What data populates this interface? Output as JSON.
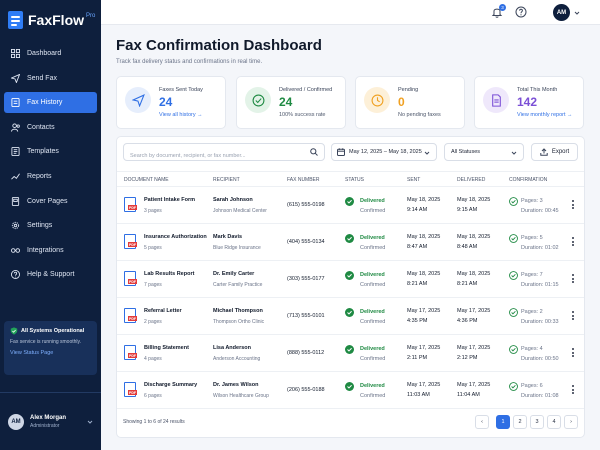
{
  "app": {
    "name": "FaxFlow",
    "badge": "Pro"
  },
  "nav": {
    "items": [
      {
        "label": "Dashboard",
        "icon": "grid-icon"
      },
      {
        "label": "Send Fax",
        "icon": "send-icon"
      },
      {
        "label": "Fax History",
        "icon": "history-icon",
        "active": true
      },
      {
        "label": "Contacts",
        "icon": "contacts-icon"
      },
      {
        "label": "Templates",
        "icon": "template-icon"
      },
      {
        "label": "Reports",
        "icon": "reports-icon"
      },
      {
        "label": "Cover Pages",
        "icon": "cover-icon"
      },
      {
        "label": "Settings",
        "icon": "gear-icon"
      },
      {
        "label": "Integrations",
        "icon": "integrations-icon"
      },
      {
        "label": "Help & Support",
        "icon": "help-icon"
      }
    ]
  },
  "system_status": {
    "title": "All Systems Operational",
    "desc": "Fax service is running smoothly.",
    "link": "View Status Page"
  },
  "user": {
    "initials": "AM",
    "name": "Alex Morgan",
    "role": "Administrator"
  },
  "topbar": {
    "notifications": "3",
    "avatar": "AM"
  },
  "page": {
    "title": "Fax Confirmation Dashboard",
    "subtitle": "Track fax delivery status and confirmations in real time."
  },
  "stats": [
    {
      "label": "Faxes Sent Today",
      "value": "24",
      "sub": "View all history →",
      "color": "#2f6fe4"
    },
    {
      "label": "Delivered / Confirmed",
      "value": "24",
      "sub": "100% success rate",
      "color": "#1f8a43"
    },
    {
      "label": "Pending",
      "value": "0",
      "sub": "No pending faxes",
      "color": "#f0a020"
    },
    {
      "label": "Total This Month",
      "value": "142",
      "sub": "View monthly report →",
      "color": "#7b4fd6"
    }
  ],
  "toolbar": {
    "search_placeholder": "Search by document, recipient, or fax number...",
    "date_range": "May 12, 2025 – May 18, 2025",
    "status_filter": "All Statuses",
    "export": "Export"
  },
  "table": {
    "headers": [
      "DOCUMENT NAME",
      "RECIPIENT",
      "FAX NUMBER",
      "STATUS",
      "SENT",
      "DELIVERED",
      "CONFIRMATION"
    ],
    "rows": [
      {
        "doc": "Patient Intake Form",
        "pages": "3 pages",
        "recipient": "Sarah Johnson",
        "org": "Johnson Medical Center",
        "fax": "(615) 555-0198",
        "status": "Delivered",
        "confirm": "Confirmed",
        "sent_date": "May 18, 2025",
        "sent_time": "9:14 AM",
        "del_date": "May 18, 2025",
        "del_time": "9:15 AM",
        "conf_pages": "Pages: 3",
        "duration": "Duration: 00:45"
      },
      {
        "doc": "Insurance Authorization",
        "pages": "5 pages",
        "recipient": "Mark Davis",
        "org": "Blue Ridge Insurance",
        "fax": "(404) 555-0134",
        "status": "Delivered",
        "confirm": "Confirmed",
        "sent_date": "May 18, 2025",
        "sent_time": "8:47 AM",
        "del_date": "May 18, 2025",
        "del_time": "8:48 AM",
        "conf_pages": "Pages: 5",
        "duration": "Duration: 01:02"
      },
      {
        "doc": "Lab Results Report",
        "pages": "7 pages",
        "recipient": "Dr. Emily Carter",
        "org": "Carter Family Practice",
        "fax": "(303) 555-0177",
        "status": "Delivered",
        "confirm": "Confirmed",
        "sent_date": "May 18, 2025",
        "sent_time": "8:21 AM",
        "del_date": "May 18, 2025",
        "del_time": "8:21 AM",
        "conf_pages": "Pages: 7",
        "duration": "Duration: 01:15"
      },
      {
        "doc": "Referral Letter",
        "pages": "2 pages",
        "recipient": "Michael Thompson",
        "org": "Thompson Ortho Clinic",
        "fax": "(713) 555-0101",
        "status": "Delivered",
        "confirm": "Confirmed",
        "sent_date": "May 17, 2025",
        "sent_time": "4:35 PM",
        "del_date": "May 17, 2025",
        "del_time": "4:36 PM",
        "conf_pages": "Pages: 2",
        "duration": "Duration: 00:33"
      },
      {
        "doc": "Billing Statement",
        "pages": "4 pages",
        "recipient": "Lisa Anderson",
        "org": "Anderson Accounting",
        "fax": "(888) 555-0112",
        "status": "Delivered",
        "confirm": "Confirmed",
        "sent_date": "May 17, 2025",
        "sent_time": "2:11 PM",
        "del_date": "May 17, 2025",
        "del_time": "2:12 PM",
        "conf_pages": "Pages: 4",
        "duration": "Duration: 00:50"
      },
      {
        "doc": "Discharge Summary",
        "pages": "6 pages",
        "recipient": "Dr. James Wilson",
        "org": "Wilson Healthcare Group",
        "fax": "(206) 555-0188",
        "status": "Delivered",
        "confirm": "Confirmed",
        "sent_date": "May 17, 2025",
        "sent_time": "11:03 AM",
        "del_date": "May 17, 2025",
        "del_time": "11:04 AM",
        "conf_pages": "Pages: 6",
        "duration": "Duration: 01:08"
      }
    ]
  },
  "pagination": {
    "summary": "Showing 1 to 6 of 24 results",
    "prev": "‹",
    "next": "›",
    "pages": [
      "1",
      "2",
      "3",
      "4"
    ],
    "current": "1"
  },
  "colors": {
    "sidebar": "#0e1f3d",
    "accent": "#2f6fe4",
    "success": "#1f8a43",
    "pdf": "#e23b3b"
  }
}
